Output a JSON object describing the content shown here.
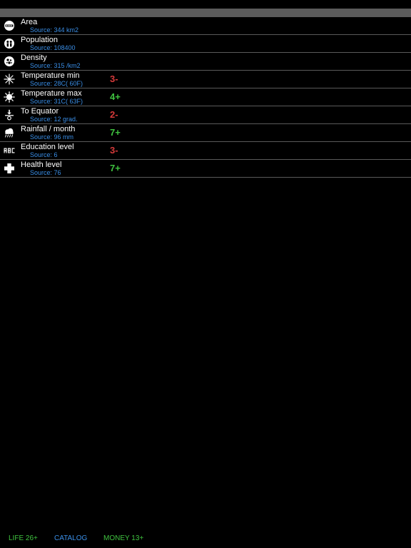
{
  "colors": {
    "background": "#000000",
    "top_bar": "#5b5b5b",
    "label": "#ffffff",
    "source": "#3a8ee6",
    "negative": "#d63a3a",
    "positive": "#3fc23f",
    "divider": "#5a5a5a"
  },
  "stats": [
    {
      "icon": "area-icon",
      "label": "Area",
      "source": "Source: 344 km2",
      "score": "",
      "tone": ""
    },
    {
      "icon": "population-icon",
      "label": "Population",
      "source": "Source: 108400",
      "score": "",
      "tone": ""
    },
    {
      "icon": "density-icon",
      "label": "Density",
      "source": "Source: 315 /km2",
      "score": "",
      "tone": ""
    },
    {
      "icon": "snowflake-icon",
      "label": "Temperature min",
      "source": "Source: 28C( 60F)",
      "score": "3-",
      "tone": "negative"
    },
    {
      "icon": "sun-icon",
      "label": "Temperature max",
      "source": "Source: 31C( 63F)",
      "score": "4+",
      "tone": "positive"
    },
    {
      "icon": "equator-icon",
      "label": "To Equator",
      "source": "Source: 12 grad.",
      "score": "2-",
      "tone": "negative"
    },
    {
      "icon": "rain-cloud-icon",
      "label": "Rainfall / month",
      "source": "Source: 96 mm",
      "score": "7+",
      "tone": "positive"
    },
    {
      "icon": "abc-icon",
      "label": "Education level",
      "source": "Source: 6",
      "score": "3-",
      "tone": "negative"
    },
    {
      "icon": "health-cross-icon",
      "label": "Health level",
      "source": "Source: 76",
      "score": "7+",
      "tone": "positive"
    }
  ],
  "bottom_bar": {
    "life": "LIFE 26+",
    "catalog": "CATALOG",
    "money": "MONEY 13+"
  }
}
